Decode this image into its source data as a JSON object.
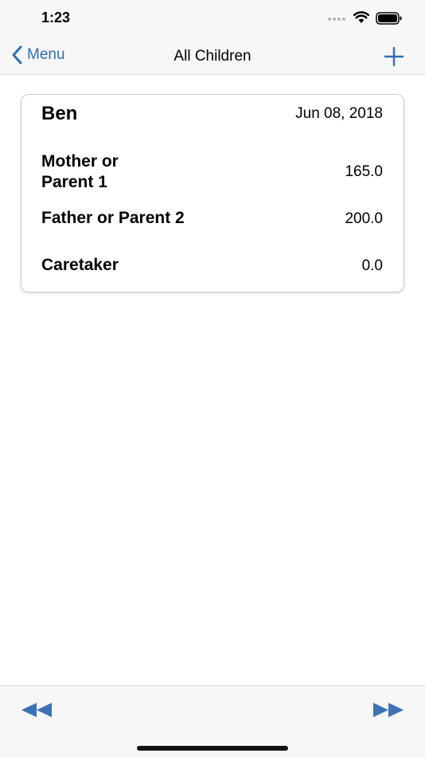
{
  "status_bar": {
    "time": "1:23"
  },
  "nav": {
    "back_label": "Menu",
    "title": "All Children"
  },
  "child": {
    "name": "Ben",
    "date": "Jun 08, 2018",
    "rows": [
      {
        "label": "Mother or Parent 1",
        "value": "165.0"
      },
      {
        "label": "Father or Parent 2",
        "value": "200.0"
      },
      {
        "label": "Caretaker",
        "value": "0.0"
      }
    ]
  },
  "icons": {
    "back": "chevron-left-icon",
    "add": "plus-icon",
    "rewind": "rewind-icon",
    "forward": "fast-forward-icon"
  },
  "colors": {
    "accent": "#2c6fb5",
    "toolbar_icon": "#3d72b4"
  }
}
